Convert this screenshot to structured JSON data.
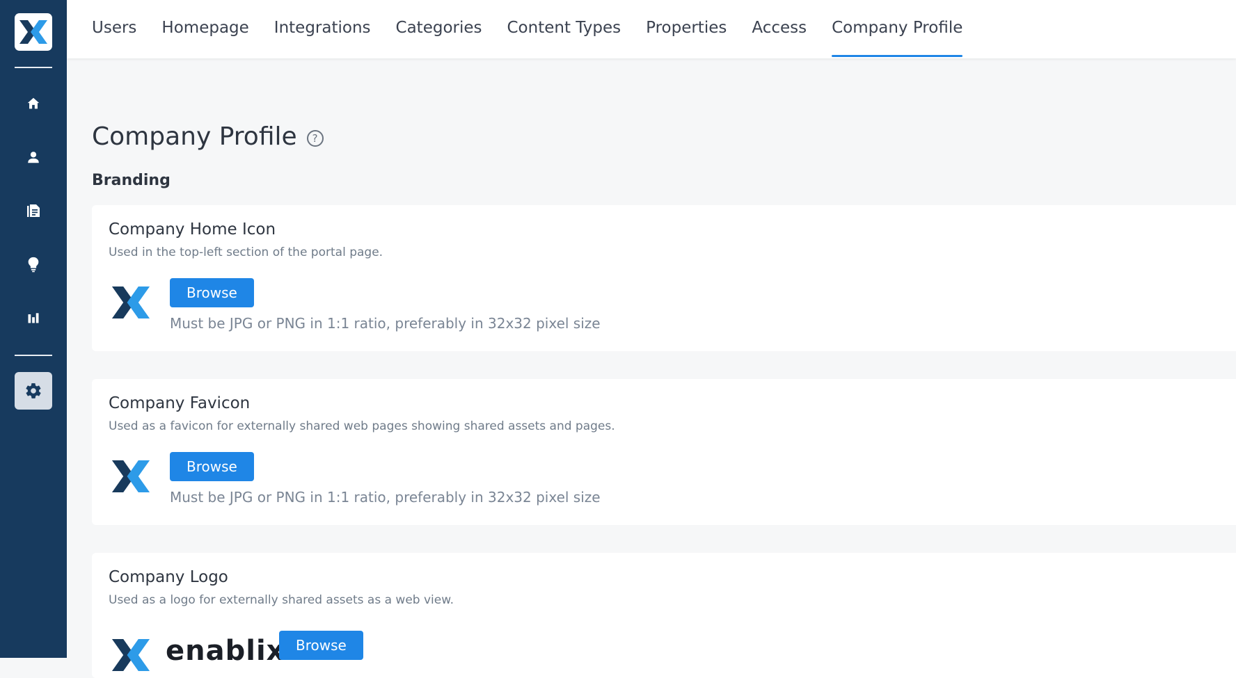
{
  "colors": {
    "sidebar_bg": "#173a5e",
    "accent": "#1f86e6",
    "logo_dark": "#183a5c",
    "logo_light": "#2d9be8"
  },
  "sidebar": {
    "brand_icon": "enablix-logo-icon",
    "items": [
      {
        "name": "home-icon",
        "active": false
      },
      {
        "name": "user-icon",
        "active": false
      },
      {
        "name": "document-icon",
        "active": false
      },
      {
        "name": "lightbulb-icon",
        "active": false
      },
      {
        "name": "bar-chart-icon",
        "active": false
      },
      {
        "name": "gear-icon",
        "active": true
      }
    ]
  },
  "nav": {
    "tabs": [
      {
        "label": "Users"
      },
      {
        "label": "Homepage"
      },
      {
        "label": "Integrations"
      },
      {
        "label": "Categories"
      },
      {
        "label": "Content Types"
      },
      {
        "label": "Properties"
      },
      {
        "label": "Access"
      },
      {
        "label": "Company Profile"
      }
    ],
    "active_tab": "Company Profile"
  },
  "page": {
    "title": "Company Profile",
    "help_symbol": "?",
    "section": "Branding"
  },
  "cards": [
    {
      "title": "Company Home Icon",
      "description": "Used in the top-left section of the portal page.",
      "button": "Browse",
      "hint": "Must be JPG or PNG in 1:1 ratio, preferably in 32x32 pixel size"
    },
    {
      "title": "Company Favicon",
      "description": "Used as a favicon for externally shared web pages showing shared assets and pages.",
      "button": "Browse",
      "hint": "Must be JPG or PNG in 1:1 ratio, preferably in 32x32 pixel size"
    },
    {
      "title": "Company Logo",
      "description": "Used as a logo for externally shared assets as a web view.",
      "button": "Browse",
      "logo_text": "enablix"
    }
  ]
}
